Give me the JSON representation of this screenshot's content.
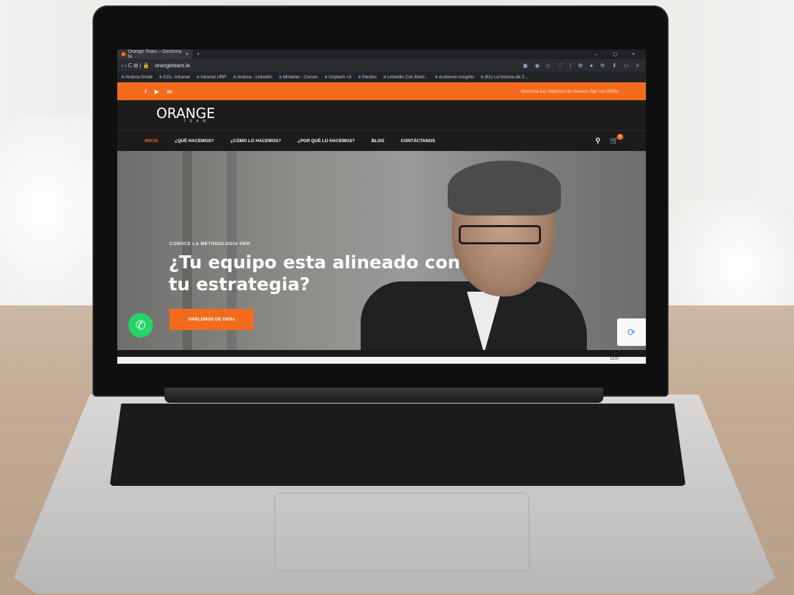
{
  "browser": {
    "tab_title": "Orange Team – Gestiona tu",
    "tab_close": "×",
    "new_tab": "+",
    "window_controls": "–  ▢  ×",
    "nav_buttons": "‹  ›  C  ⊞  |  🔒",
    "url": "orangeteam.la",
    "ext_icons": "▣ ◉ ▷ ♡ | ✿ ● ⚙ ⬇ ▭ ≡",
    "bookmarks": [
      "Andrea Gmail",
      "CCL- Intranet",
      "Intranet URP",
      "Andrea - LinkedIn",
      "Miriadax - Cursos",
      "Unplash <3",
      "Perdoo",
      "Linkedin Con Marti...",
      "Audience Insights",
      "(61) La historia de Z..."
    ]
  },
  "site": {
    "social": [
      "f",
      "▶",
      "in"
    ],
    "promo": "Gestiona tus Objetivos de manera Ágil con OKRs",
    "logo": "ORANGE",
    "logo_sub": "TEAM",
    "nav": [
      "INICIO",
      "¿QUÉ HACEMOS?",
      "¿CÓMO LO HACEMOS?",
      "¿POR QUÉ LO HACEMOS?",
      "BLOG",
      "CONTÁCTANOS"
    ],
    "search_icon": "⚲",
    "cart_icon": "🛒",
    "cart_count": "0",
    "hero": {
      "eyebrow": "CONOCE LA METODOLOGÍA OKR",
      "headline": "¿Tu equipo esta alineado con tu estrategia?",
      "cta": "HABLEMOS DE OKRs"
    },
    "clock": "13:33"
  },
  "colors": {
    "accent": "#f26b1d",
    "dark": "#1d1b1b",
    "whatsapp": "#25d366"
  }
}
